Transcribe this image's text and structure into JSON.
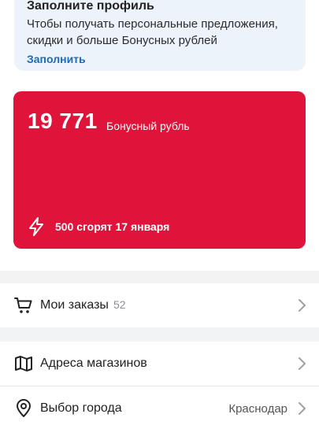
{
  "profile": {
    "title": "Заполните профиль",
    "description": "Чтобы получать персональные предложения, скидки и больше Бонусных рублей",
    "link_label": "Заполнить"
  },
  "bonus": {
    "amount": "19 771",
    "label": "Бонусный рубль",
    "expire_text": "500 сгорят 17 января",
    "color": "#e0143a"
  },
  "menu": {
    "orders": {
      "label": "Мои заказы",
      "count": "52",
      "icon": "cart-icon"
    },
    "stores": {
      "label": "Адреса магазинов",
      "icon": "map-icon"
    },
    "city": {
      "label": "Выбор города",
      "value": "Краснодар",
      "icon": "location-pin-icon"
    }
  }
}
